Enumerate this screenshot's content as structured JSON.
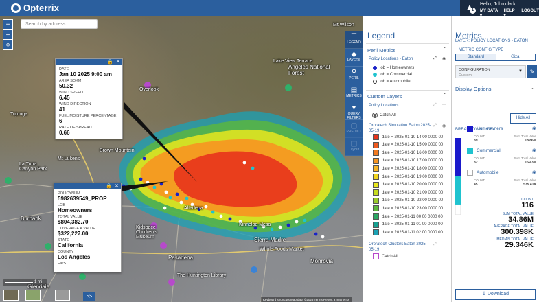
{
  "header": {
    "brand": "Opterrix",
    "greeting": "Hello, John.clark",
    "notification_count": "1",
    "links": [
      "MY DATA",
      "HELP",
      "LOGOUT"
    ]
  },
  "map": {
    "search_placeholder": "Search by address",
    "labels": [
      "Mt Wilson",
      "Lake View Terrace",
      "Angeles National Forest",
      "Tujunga",
      "Overlook",
      "Brown Mountain",
      "La Tuna Canyon Park",
      "Mt Lukens",
      "Burbank",
      "Altadena",
      "Kinneloa Mesa",
      "Sierra Madre",
      "Pasadena",
      "Whole Foods Market",
      "Kidspace Children's Museum",
      "The Huntington Library",
      "Monrovia",
      "Glendale"
    ],
    "scale_label": "1 mi",
    "expand_label": ">>",
    "attribution": "Keyboard shortcuts   Map data ©2025   Terms   Report a map error"
  },
  "popup_fire": {
    "fields": [
      {
        "label": "DATE",
        "value": "Jan 10 2025 9:00 am"
      },
      {
        "label": "AREA SQKM",
        "value": "50.32"
      },
      {
        "label": "WIND SPEED",
        "value": "6.45"
      },
      {
        "label": "WIND DIRECTION",
        "value": "41"
      },
      {
        "label": "FUEL MOISTURE PERCENTAGE",
        "value": "6"
      },
      {
        "label": "RATE OF SPREAD",
        "value": "0.66"
      }
    ]
  },
  "popup_policy": {
    "fields": [
      {
        "label": "POLICYNUM",
        "value": "5982639549_PROP"
      },
      {
        "label": "LOB",
        "value": "Homeowners"
      },
      {
        "label": "TOTAL VALUE",
        "value": "$804,382.70"
      },
      {
        "label": "COVERAGE A VALUE",
        "value": "$322,227.00"
      },
      {
        "label": "STATE",
        "value": "California"
      },
      {
        "label": "COUNTY",
        "value": "Los Angeles"
      },
      {
        "label": "FIPS",
        "value": ""
      }
    ]
  },
  "rail": [
    {
      "label": "LEGEND",
      "icon": "list-icon"
    },
    {
      "label": "LAYERS",
      "icon": "layers-icon"
    },
    {
      "label": "PERIL",
      "icon": "search-icon"
    },
    {
      "label": "METRICS",
      "icon": "bar-chart-icon"
    },
    {
      "label": "QUERY FILTERS",
      "icon": "filter-icon"
    },
    {
      "label": "PREDICT",
      "icon": "predict-icon"
    },
    {
      "label": "Layout",
      "icon": "layout-icon"
    }
  ],
  "legend": {
    "title": "Legend",
    "peril_metrics": "Peril Metrics",
    "policy_eaton": "Policy Locations - Eaton",
    "lob_items": [
      {
        "label": "lob = Homeowners",
        "color": "#1a22c8"
      },
      {
        "label": "lob = Commercial",
        "color": "#1fc3cf"
      },
      {
        "label": "lob = Automobile",
        "color": "#ffffff"
      }
    ],
    "custom_layers": "Custom Layers",
    "policy_locations": "Policy Locations",
    "catch_all": "Catch All",
    "simulation_title": "Ororatech Simulation Eaton 2025-05-19",
    "date_items": [
      {
        "label": "date = 2025-01-10 14 00 0000 00",
        "color": "#e8341c"
      },
      {
        "label": "date = 2025-01-10 15 00 0000 00",
        "color": "#ee5a1e"
      },
      {
        "label": "date = 2025-01-10 16 00 0000 00",
        "color": "#f27a1f"
      },
      {
        "label": "date = 2025-01-10 17 00 0000 00",
        "color": "#f79521"
      },
      {
        "label": "date = 2025-01-10 18 00 0000 00",
        "color": "#f7b524"
      },
      {
        "label": "date = 2025-01-10 19 00 0000 00",
        "color": "#f2d51f"
      },
      {
        "label": "date = 2025-01-10 20 00 0000 00",
        "color": "#e9e81d"
      },
      {
        "label": "date = 2025-01-10 21 00 0000 00",
        "color": "#c7dc1f"
      },
      {
        "label": "date = 2025-01-10 22 00 0000 00",
        "color": "#9bcb2b"
      },
      {
        "label": "date = 2025-01-10 23 00 0000 00",
        "color": "#5cb83b"
      },
      {
        "label": "date = 2025-01-11 00 00 0000 00",
        "color": "#2aa662"
      },
      {
        "label": "date = 2025-01-11 01 00 0000 00",
        "color": "#16a191"
      },
      {
        "label": "date = 2025-01-11 02 00 0000 00",
        "color": "#1aa2b5"
      }
    ],
    "clusters_title": "Ororatech Clusters Eaton 2025-05-19",
    "clusters_catch_all": "Catch All"
  },
  "metrics": {
    "title": "Metrics",
    "layer": "LAYER: POLICY LOCATIONS - EATON",
    "config_type_label": "METRIC CONFIG TYPE",
    "config_options": [
      "Standard",
      "Giza"
    ],
    "config_selected": "Standard",
    "configuration_label": "CONFIGURATION",
    "configuration_value": "Custom",
    "display_options": "Display Options",
    "hide_all": "Hide All",
    "breakdown": "BREAKDOWN: LOB",
    "lob_breakdown": [
      {
        "name": "Homeowners",
        "color": "#1a1acb",
        "count_label": "COUNT",
        "count": "39",
        "sum_label": "Sum Total Value",
        "sum": "18.86M"
      },
      {
        "name": "Commercial",
        "color": "#1fc3cf",
        "count_label": "COUNT",
        "count": "32",
        "sum_label": "Sum Total Value",
        "sum": "15.43M"
      },
      {
        "name": "Automobile",
        "color": "#ffffff",
        "count_label": "COUNT",
        "count": "45",
        "sum_label": "Sum Total Value",
        "sum": "535.41K"
      }
    ],
    "bar_shares": [
      0.5,
      0.37,
      0.13
    ],
    "totals": [
      {
        "label": "COUNT",
        "value": "116"
      },
      {
        "label": "SUM TOTAL VALUE",
        "value": "34.86M"
      },
      {
        "label": "AVERAGE TOTAL VALUE",
        "value": "300.398K"
      },
      {
        "label": "MEDIAN TOTAL VALUE",
        "value": "29.346K"
      }
    ],
    "download": "Download"
  },
  "colors": {
    "brand_blue": "#2b5f9e",
    "header_dark": "#1a2a40"
  }
}
